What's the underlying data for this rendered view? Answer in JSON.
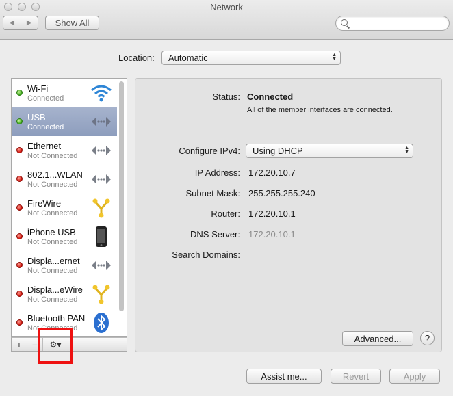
{
  "window": {
    "title": "Network",
    "toolbar": {
      "back_icon": "chevron-left-icon",
      "forward_icon": "chevron-right-icon",
      "show_all_label": "Show All",
      "search_placeholder": ""
    }
  },
  "location": {
    "label": "Location:",
    "selected": "Automatic"
  },
  "services": [
    {
      "name": "Wi-Fi",
      "status": "Connected",
      "indicator": "green",
      "icon": "wifi-icon"
    },
    {
      "name": "USB",
      "status": "Connected",
      "indicator": "green",
      "icon": "ethernet-arrows-icon",
      "selected": true
    },
    {
      "name": "Ethernet",
      "status": "Not Connected",
      "indicator": "red",
      "icon": "ethernet-arrows-icon"
    },
    {
      "name": "802.1...WLAN",
      "status": "Not Connected",
      "indicator": "red",
      "icon": "ethernet-arrows-icon"
    },
    {
      "name": "FireWire",
      "status": "Not Connected",
      "indicator": "red",
      "icon": "firewire-icon"
    },
    {
      "name": "iPhone USB",
      "status": "Not Connected",
      "indicator": "red",
      "icon": "iphone-icon"
    },
    {
      "name": "Displa...ernet",
      "status": "Not Connected",
      "indicator": "red",
      "icon": "ethernet-arrows-icon"
    },
    {
      "name": "Displa...eWire",
      "status": "Not Connected",
      "indicator": "red",
      "icon": "firewire-icon"
    },
    {
      "name": "Bluetooth PAN",
      "status": "Not Connected",
      "indicator": "red",
      "icon": "bluetooth-icon"
    }
  ],
  "sidebar_buttons": {
    "add": "+",
    "remove": "−",
    "action": "⚙▾"
  },
  "details": {
    "status_label": "Status:",
    "status_value": "Connected",
    "status_description": "All of the member interfaces are connected.",
    "configure_label": "Configure IPv4:",
    "configure_value": "Using DHCP",
    "ip_label": "IP Address:",
    "ip_value": "172.20.10.7",
    "subnet_label": "Subnet Mask:",
    "subnet_value": "255.255.255.240",
    "router_label": "Router:",
    "router_value": "172.20.10.1",
    "dns_label": "DNS Server:",
    "dns_value": "172.20.10.1",
    "search_domains_label": "Search Domains:",
    "advanced_label": "Advanced...",
    "help_label": "?"
  },
  "footer": {
    "assist_label": "Assist me...",
    "revert_label": "Revert",
    "apply_label": "Apply"
  },
  "colors": {
    "selection": "#98a6c4",
    "connected": "#39a618",
    "not_connected": "#d1130b",
    "highlight_box": "#ee1111"
  }
}
